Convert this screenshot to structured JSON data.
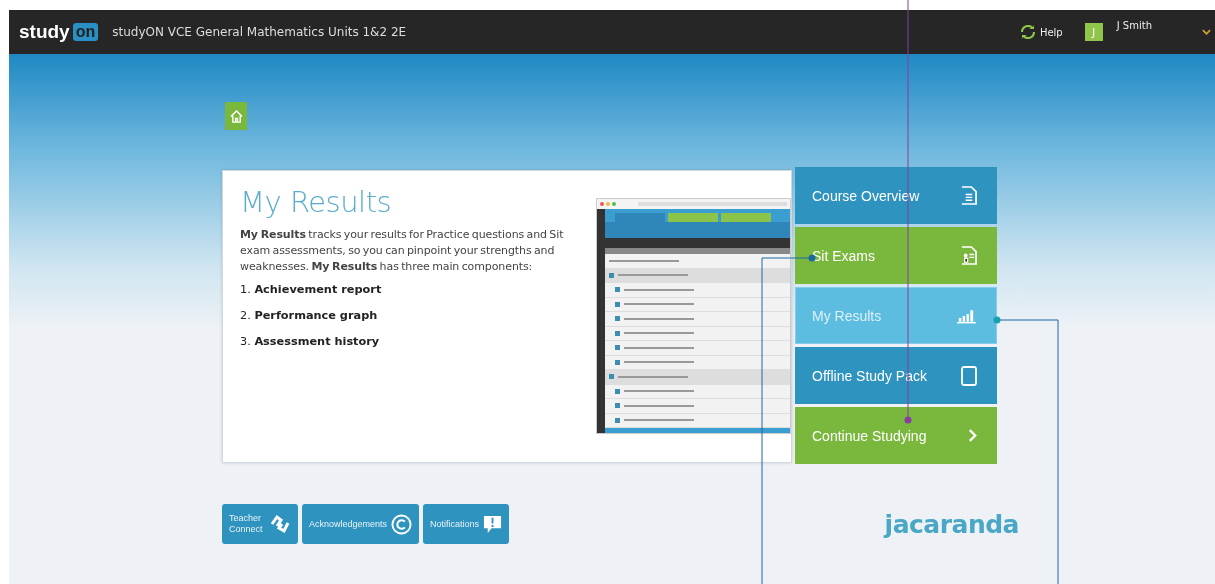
{
  "header": {
    "logo_left": "study",
    "logo_right": "on",
    "title": "studyON VCE General Mathematics Units 1&2 2E",
    "help": "Help",
    "user_initial": "J",
    "user_name": "J Smith"
  },
  "panel": {
    "title": "My Results",
    "description": "**My Results** tracks your results for Practice questions and Sit exam assessments, so you can pinpoint your strengths and weaknesses. **My Results** has three main components:",
    "components": [
      "1. **Achievement report**",
      "2. **Performance graph**",
      "3. **Assessment history**"
    ]
  },
  "menu": [
    {
      "label": "Course Overview",
      "kind": "overview",
      "color": "#2f93bf",
      "selected": false
    },
    {
      "label": "Sit Exams",
      "kind": "exams",
      "color": "#7ab83d",
      "selected": false
    },
    {
      "label": "My Results",
      "kind": "results",
      "color": "#5cbde0",
      "selected": true
    },
    {
      "label": "Offline Study Pack",
      "kind": "offline",
      "color": "#2f93bf",
      "selected": false
    },
    {
      "label": "Continue Studying",
      "kind": "continue",
      "color": "#7ab83d",
      "selected": false
    }
  ],
  "footer_buttons": [
    {
      "label": "Teacher Connect",
      "kind": "teacher"
    },
    {
      "label": "Acknowledgements",
      "kind": "copyright"
    },
    {
      "label": "Notifications",
      "kind": "notice"
    }
  ],
  "brand": "jacaranda"
}
